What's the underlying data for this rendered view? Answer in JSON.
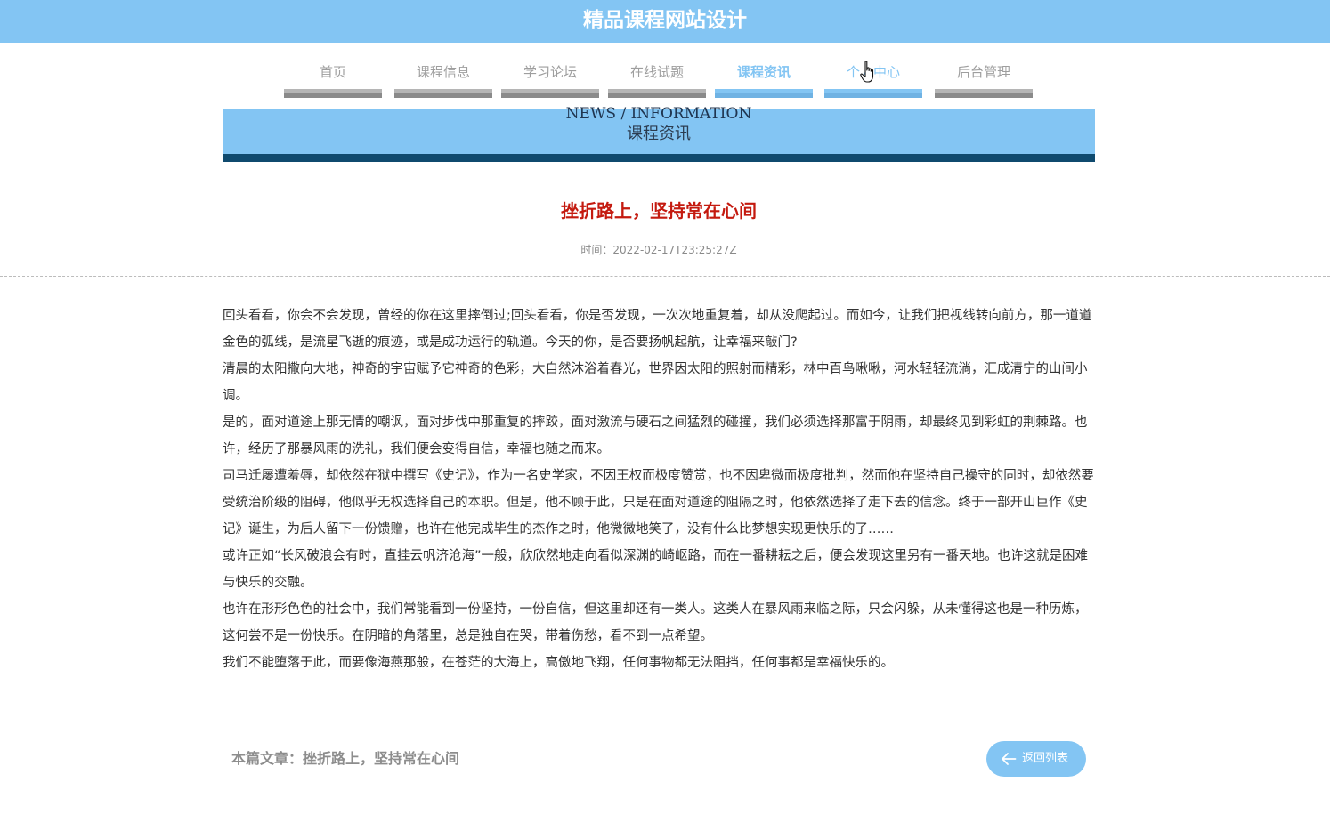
{
  "header": {
    "site_title": "精品课程网站设计"
  },
  "nav": {
    "items": [
      {
        "label": "首页"
      },
      {
        "label": "课程信息"
      },
      {
        "label": "学习论坛"
      },
      {
        "label": "在线试题"
      },
      {
        "label": "课程资讯"
      },
      {
        "label": "个人中心"
      },
      {
        "label": "后台管理"
      }
    ],
    "active": "课程资讯",
    "hovered": "个人中心"
  },
  "banner": {
    "en": "NEWS / INFORMATION",
    "cn": "课程资讯"
  },
  "article": {
    "title": "挫折路上，坚持常在心间",
    "time": "时间：2022-02-17T23:25:27Z",
    "paragraphs": [
      "回头看看，你会不会发现，曾经的你在这里摔倒过;回头看看，你是否发现，一次次地重复着，却从没爬起过。而如今，让我们把视线转向前方，那一道道金色的弧线，是流星飞逝的痕迹，或是成功运行的轨道。今天的你，是否要扬帆起航，让幸福来敲门?",
      "清晨的太阳撒向大地，神奇的宇宙赋予它神奇的色彩，大自然沐浴着春光，世界因太阳的照射而精彩，林中百鸟啾啾，河水轻轻流淌，汇成清宁的山间小调。",
      "是的，面对道途上那无情的嘲讽，面对步伐中那重复的摔跤，面对激流与硬石之间猛烈的碰撞，我们必须选择那富于阴雨，却最终见到彩虹的荆棘路。也许，经历了那暴风雨的洗礼，我们便会变得自信，幸福也随之而来。",
      "司马迁屡遭羞辱，却依然在狱中撰写《史记》，作为一名史学家，不因王权而极度赞赏，也不因卑微而极度批判，然而他在坚持自己操守的同时，却依然要受统治阶级的阻碍，他似乎无权选择自己的本职。但是，他不顾于此，只是在面对道途的阻隔之时，他依然选择了走下去的信念。终于一部开山巨作《史记》诞生，为后人留下一份馈赠，也许在他完成毕生的杰作之时，他微微地笑了，没有什么比梦想实现更快乐的了……",
      "或许正如“长风破浪会有时，直挂云帆济沧海”一般，欣欣然地走向看似深渊的崎岖路，而在一番耕耘之后，便会发现这里另有一番天地。也许这就是困难与快乐的交融。",
      "也许在形形色色的社会中，我们常能看到一份坚持，一份自信，但这里却还有一类人。这类人在暴风雨来临之际，只会闪躲，从未懂得这也是一种历炼，这何尝不是一份快乐。在阴暗的角落里，总是独自在哭，带着伤愁，看不到一点希望。",
      "我们不能堕落于此，而要像海燕那般，在苍茫的大海上，高傲地飞翔，任何事物都无法阻挡，任何事都是幸福快乐的。"
    ]
  },
  "footer": {
    "current_article": "本篇文章：挫折路上，坚持常在心间",
    "back_label": "返回列表"
  },
  "colors": {
    "accent": "#83c5f3",
    "banner_strip": "#0f4a6e",
    "title_red": "#c41a0f"
  },
  "icons": {
    "back": "arrow-left-icon",
    "cursor": "hand-pointer-icon"
  }
}
